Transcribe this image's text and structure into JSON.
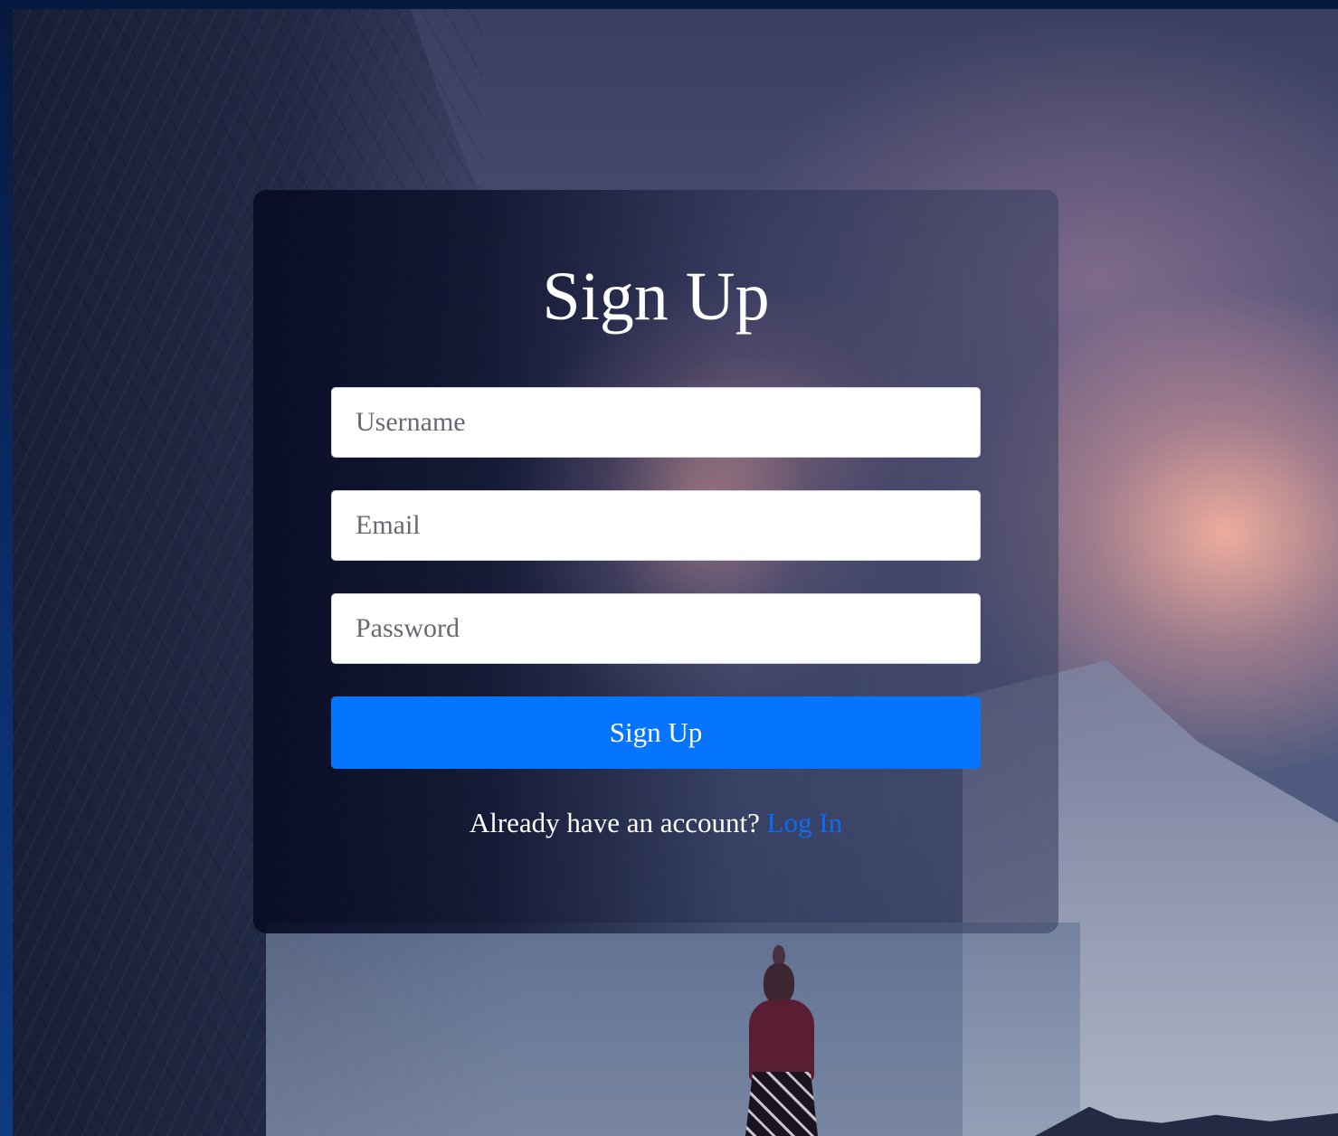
{
  "signup": {
    "title": "Sign Up",
    "username_placeholder": "Username",
    "email_placeholder": "Email",
    "password_placeholder": "Password",
    "submit_label": "Sign Up",
    "login_prompt": "Already have an account?",
    "login_link_label": "Log In"
  },
  "colors": {
    "accent": "#0475fc",
    "link": "#0a6cf5"
  }
}
